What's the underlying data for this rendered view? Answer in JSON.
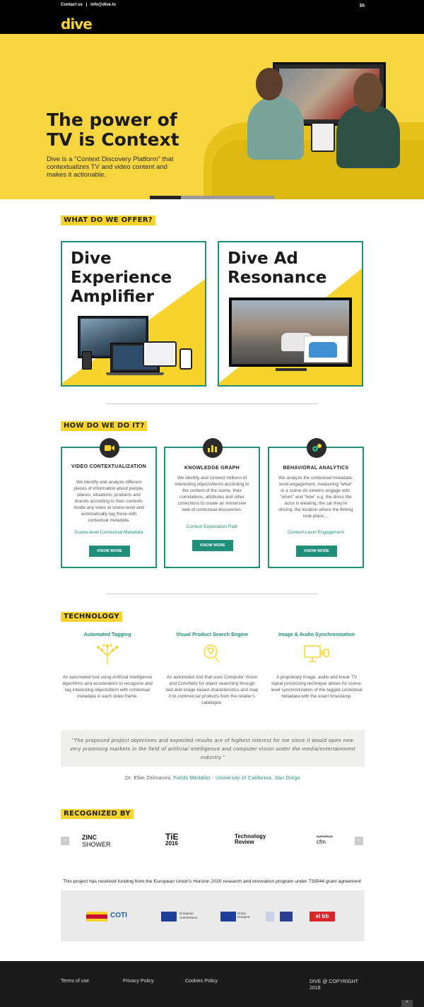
{
  "topbar": {
    "contact_label": "Contact us",
    "separator": "|",
    "email": "info@dive.tv",
    "linkedin_label": "in"
  },
  "nav": {
    "logo_text": "dive"
  },
  "hero": {
    "title": "The power of TV is Context",
    "description": "Dive is a \"Context Discovery Platform\" that contextualizes TV and video content and makes it actionable.",
    "slides": 4,
    "active_slide": 1
  },
  "offer": {
    "heading": "WHAT DO WE OFFER?",
    "cards": [
      {
        "title": "Dive Experience Amplifier"
      },
      {
        "title": "Dive Ad Resonance"
      }
    ]
  },
  "how": {
    "heading": "HOW DO WE DO IT?",
    "cards": [
      {
        "icon": "video-camera-icon",
        "title": "VIDEO CONTEXTUALIZATION",
        "description": "We identify and analyze different pieces of information about people, places, situations, products and brands according to their contexts inside any video at scene-level and automatically tag those with contextual metadata.",
        "link": "Scene-level Contextual Metadata",
        "button": "KNOW MORE"
      },
      {
        "icon": "bar-chart-icon",
        "title": "KNOWLEDGE GRAPH",
        "description": "We identify and connect millions of interesting objects/items according to the context of the scene, their correlations, attributes and other conections to create an immersive web of contextual discoveries.",
        "link": "Context Exploration Path",
        "button": "KNOW MORE"
      },
      {
        "icon": "gears-icon",
        "title": "BEHAVIORAL ANALYTICS",
        "description": "We analyze the contextual metadata-level engagement, measuring \"what\" in a scene do viewers engage with, \"when\" and \"how\" e.g. the dress the actor is wearing, the car they're driving, the location where the filming took place....",
        "link": "Context-Level Engagement",
        "button": "KNOW MORE"
      }
    ]
  },
  "technology": {
    "heading": "TECHNOLOGY",
    "items": [
      {
        "icon": "brain-tree-icon",
        "title": "Automated Tagging",
        "description": "An automated tool using Artificial Intelligence algorithms and accelerators to recognize and tag interesting objects/item with contextual metadata in each video frame."
      },
      {
        "icon": "visual-search-icon",
        "title": "Visual Product Search Engine",
        "description": "An automated tool that uses Computer Vision and ConvNets for object searching through text and image based characteristics and map it to commercial products from the retailer's catalogue."
      },
      {
        "icon": "tv-sync-icon",
        "title": "Image & Audio Synchronization",
        "description": "A proprietary image, audio and linear TV signal processing technique allows for scene-level synchronization of the tagged contextual metadata with the exact timestamp."
      }
    ]
  },
  "quote": {
    "text": "\"The proposed project objectives and expected results are of highest interest for me since it would open new very promising markets in the field of artificial intelligence and computer vision under the media/entertainment industry.\"",
    "author_prefix": "Dr. Efim Zelmanov,",
    "author_highlight": "Fields Medalist - University of California, San Diego"
  },
  "recognized": {
    "heading": "RECOGNIZED BY",
    "logos": [
      {
        "line1": "ZINC",
        "line2": "SHOWER"
      },
      {
        "line1": "TiE",
        "line2": "2016"
      },
      {
        "line1": "Technology",
        "line2": "Review"
      },
      {
        "line1": "EUROPEAN",
        "line2": "cfm"
      }
    ],
    "prev": "‹",
    "next": "›"
  },
  "funding": {
    "text": "This project has received funding from the European Union's Horizon 2020 research and innovation program under 733544 grant agreement",
    "logos": [
      "COTI",
      "European Commission",
      "Unión Europea",
      "el bb"
    ]
  },
  "footer": {
    "terms": "Terms of use",
    "privacy": "Privacy Policy",
    "cookies": "Cookies Policy",
    "copyright_line1": "DIVE @ COPYRIGHT",
    "copyright_line2": "2018",
    "to_top": "^"
  },
  "colors": {
    "brand_yellow": "#f6d32d",
    "accent_teal": "#1f8f7a",
    "footer_bg": "#1b1b1b"
  }
}
